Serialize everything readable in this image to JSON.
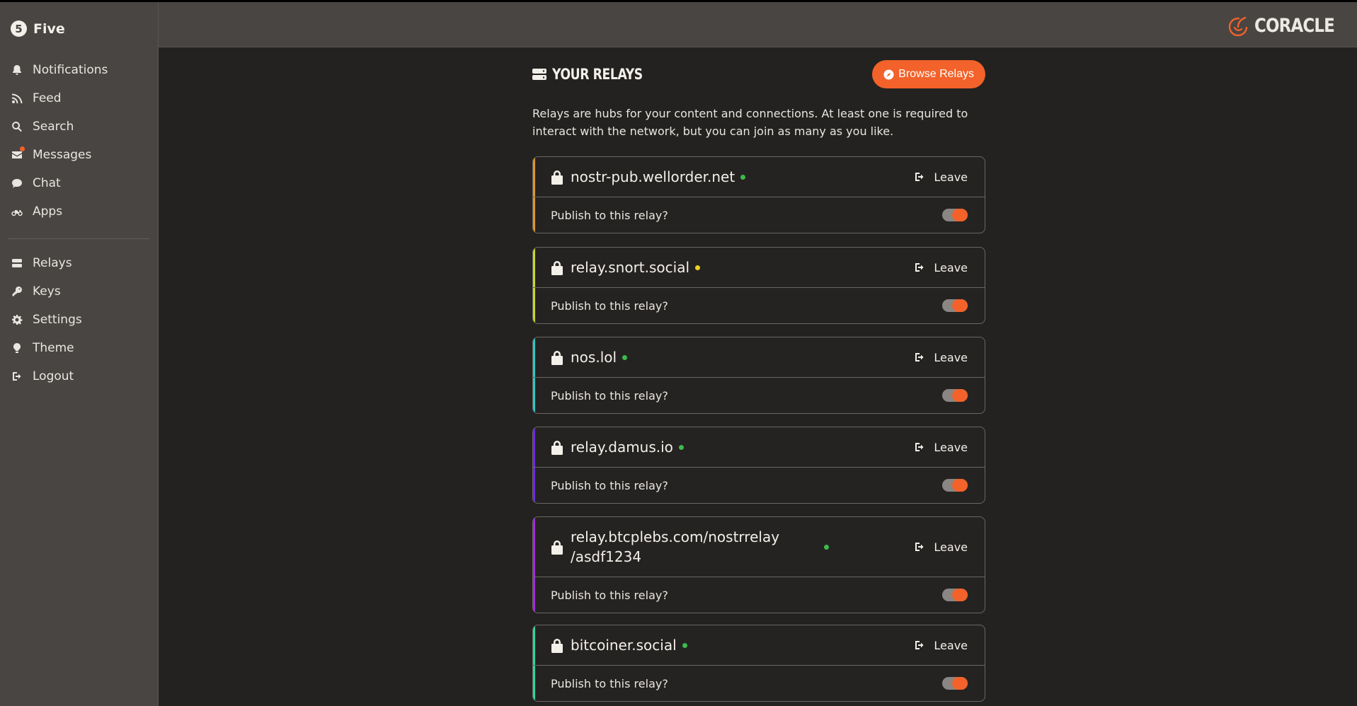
{
  "profile": {
    "avatar_glyph": "5",
    "name": "Five"
  },
  "nav": {
    "primary": [
      {
        "label": "Notifications",
        "icon": "bell-icon"
      },
      {
        "label": "Feed",
        "icon": "rss-icon"
      },
      {
        "label": "Search",
        "icon": "search-icon"
      },
      {
        "label": "Messages",
        "icon": "envelope-icon",
        "badge": true
      },
      {
        "label": "Chat",
        "icon": "chat-icon"
      },
      {
        "label": "Apps",
        "icon": "motorcycle-icon"
      }
    ],
    "secondary": [
      {
        "label": "Relays",
        "icon": "server-icon"
      },
      {
        "label": "Keys",
        "icon": "key-icon"
      },
      {
        "label": "Settings",
        "icon": "gear-icon"
      },
      {
        "label": "Theme",
        "icon": "lightbulb-icon"
      },
      {
        "label": "Logout",
        "icon": "logout-icon"
      }
    ]
  },
  "brand": {
    "name": "CORACLE",
    "accent_color": "#f2622a"
  },
  "page": {
    "title": "YOUR RELAYS",
    "browse_button": "Browse Relays",
    "description": "Relays are hubs for your content and connections. At least one is required to interact with the network, but you can join as many as you like."
  },
  "relays": [
    {
      "name": "nostr-pub.wellorder.net",
      "accent": "#e0962a",
      "status_color": "#3dba4e",
      "leave": "Leave",
      "publish_label": "Publish to this relay?",
      "publish": true
    },
    {
      "name": "relay.snort.social",
      "accent": "#c8d62a",
      "status_color": "#e8d21d",
      "leave": "Leave",
      "publish_label": "Publish to this relay?",
      "publish": true
    },
    {
      "name": "nos.lol",
      "accent": "#2ac7c7",
      "status_color": "#3dba4e",
      "leave": "Leave",
      "publish_label": "Publish to this relay?",
      "publish": true
    },
    {
      "name": "relay.damus.io",
      "accent": "#6a2ae0",
      "status_color": "#3dba4e",
      "leave": "Leave",
      "publish_label": "Publish to this relay?",
      "publish": true
    },
    {
      "name": "relay.btcplebs.com/nostrrelay/asdf1234",
      "name_line1": "relay.btcplebs.com/nostrrelay",
      "name_line2": "/asdf1234",
      "accent": "#a12ae0",
      "status_color": "#3dba4e",
      "leave": "Leave",
      "publish_label": "Publish to this relay?",
      "publish": true
    },
    {
      "name": "bitcoiner.social",
      "accent": "#2ad6a0",
      "status_color": "#3dba4e",
      "leave": "Leave",
      "publish_label": "Publish to this relay?",
      "publish": true
    }
  ]
}
